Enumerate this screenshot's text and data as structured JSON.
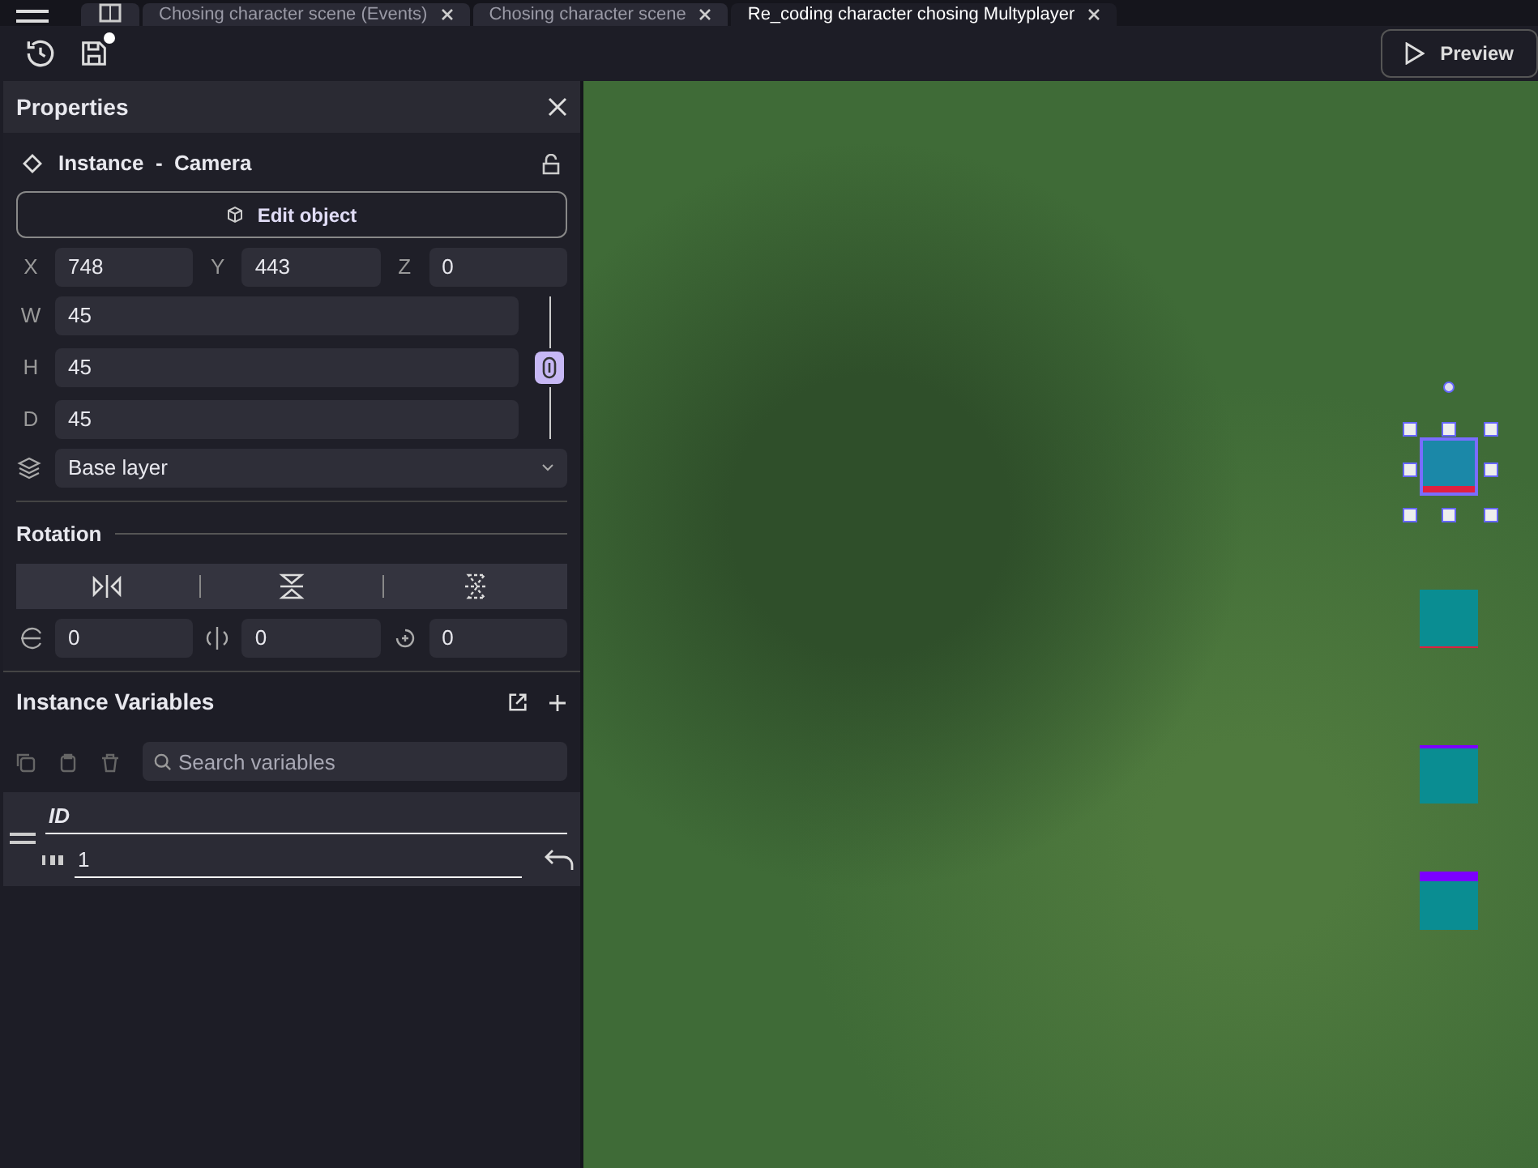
{
  "tabs": [
    {
      "label": "Chosing character scene (Events)",
      "selected": false
    },
    {
      "label": "Chosing character scene",
      "selected": false
    },
    {
      "label": "Re_coding character chosing Multyplayer",
      "selected": true
    }
  ],
  "toolbar": {
    "preview_label": "Preview"
  },
  "properties": {
    "title": "Properties",
    "instance_title": "Instance  -  Camera",
    "edit_button": "Edit object",
    "position": [
      {
        "axis": "X",
        "value": "748"
      },
      {
        "axis": "Y",
        "value": "443"
      },
      {
        "axis": "Z",
        "value": "0"
      }
    ],
    "size": [
      {
        "axis": "W",
        "value": "45"
      },
      {
        "axis": "H",
        "value": "45"
      },
      {
        "axis": "D",
        "value": "45"
      }
    ],
    "size_linked": true,
    "layer": "Base layer",
    "rotation_title": "Rotation",
    "rotation": [
      {
        "value": "0"
      },
      {
        "value": "0"
      },
      {
        "value": "0"
      }
    ]
  },
  "instance_variables": {
    "title": "Instance Variables",
    "search_placeholder": "Search variables",
    "variables": [
      {
        "name": "ID",
        "value": "1"
      }
    ]
  },
  "canvas": {
    "instances": [
      {
        "selected": true,
        "kind": "bottom"
      },
      {
        "selected": false,
        "kind": "bottomthin"
      },
      {
        "selected": false,
        "kind": "topthin"
      },
      {
        "selected": false,
        "kind": "top"
      }
    ]
  }
}
